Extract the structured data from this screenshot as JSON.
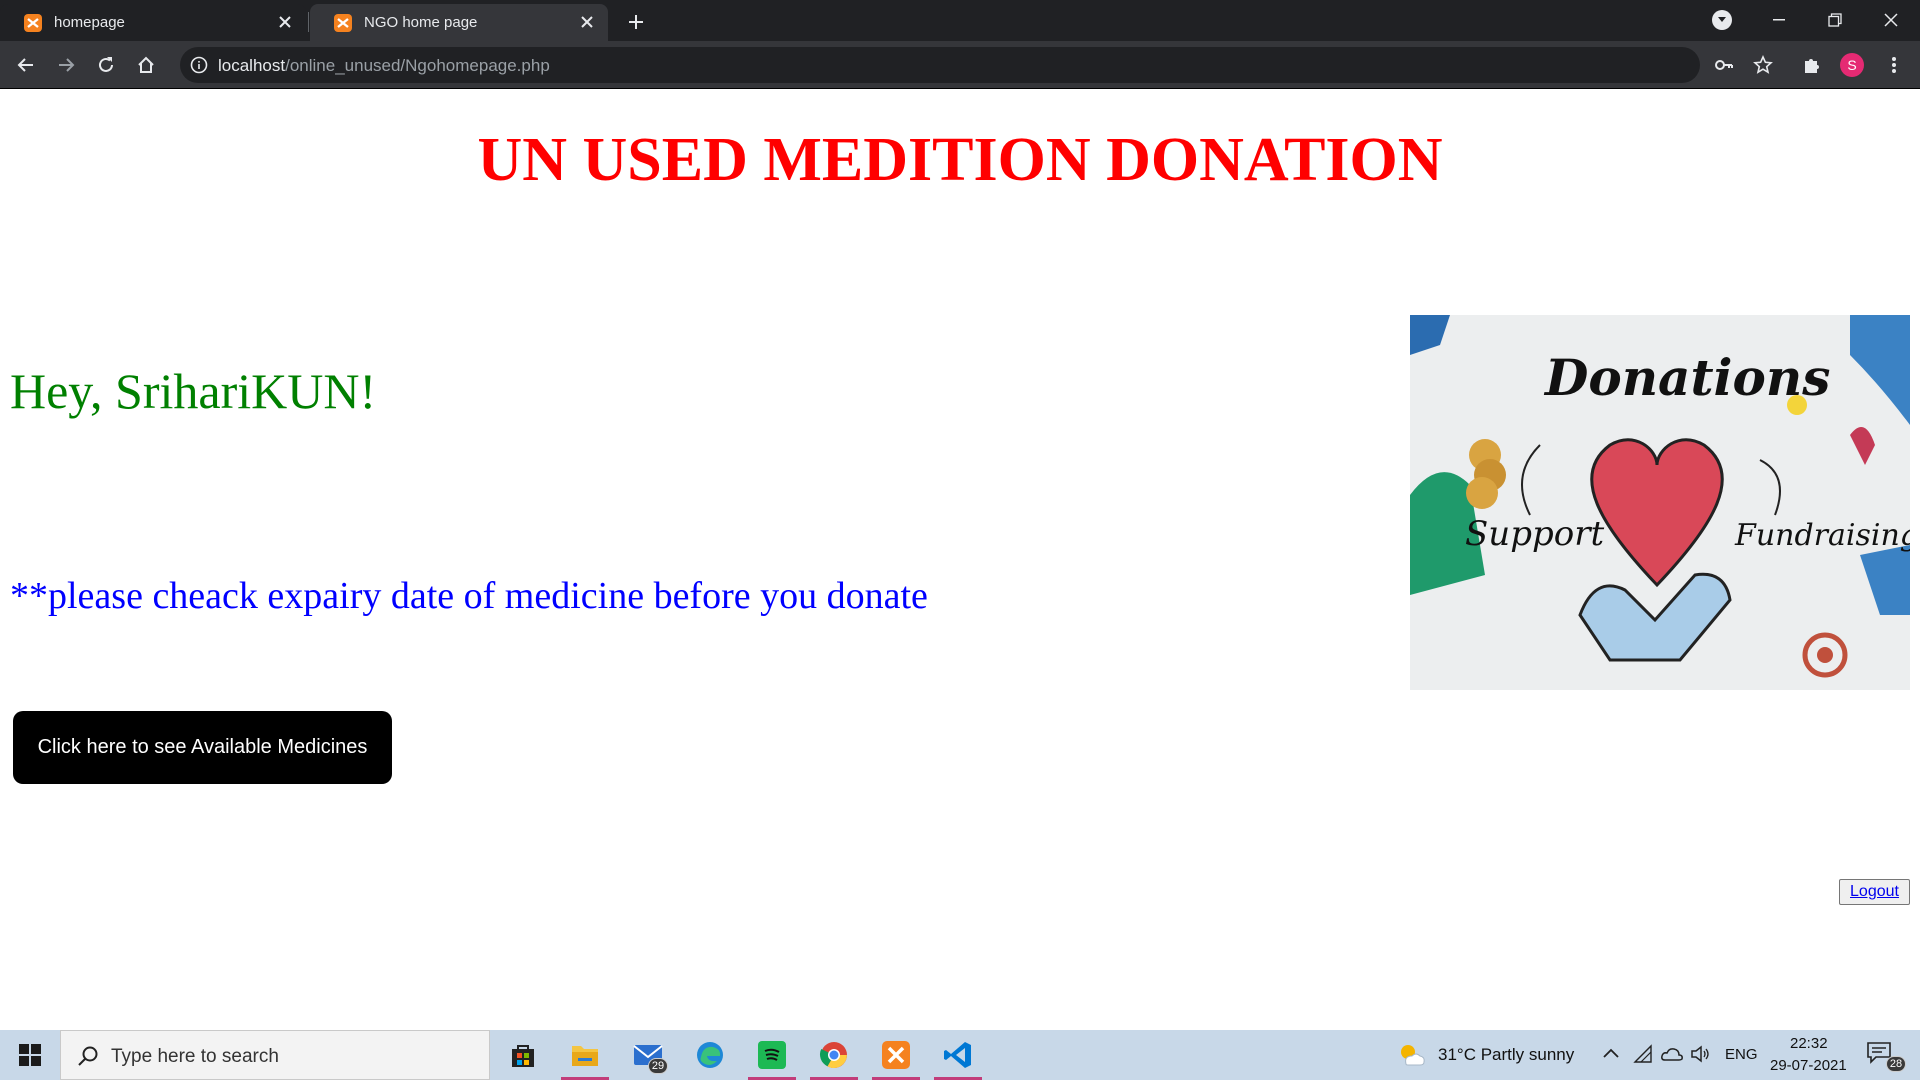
{
  "browser": {
    "tabs": [
      {
        "title": "homepage",
        "active": false
      },
      {
        "title": "NGO home page",
        "active": true
      }
    ],
    "url_host": "localhost",
    "url_path": "/online_unused/Ngohomepage.php",
    "profile_initial": "S"
  },
  "page": {
    "title": "UN USED MEDITION DONATION",
    "greeting": "Hey, SrihariKUN!",
    "notice": "**please cheack expairy date of medicine before you donate",
    "medicines_button": "Click here to see Available Medicines",
    "logout": "Logout",
    "image_text": {
      "heading": "Donations",
      "left": "Support",
      "right": "Fundraising"
    }
  },
  "taskbar": {
    "search_placeholder": "Type here to search",
    "mail_badge": "29",
    "weather": "31°C  Partly sunny",
    "language": "ENG",
    "time": "22:32",
    "date": "29-07-2021",
    "notification_badge": "28"
  },
  "colors": {
    "title": "#ff0000",
    "greeting": "#008000",
    "notice": "#0000ff",
    "button_bg": "#000000",
    "chrome_dark": "#202124",
    "chrome_toolbar": "#35363a"
  }
}
